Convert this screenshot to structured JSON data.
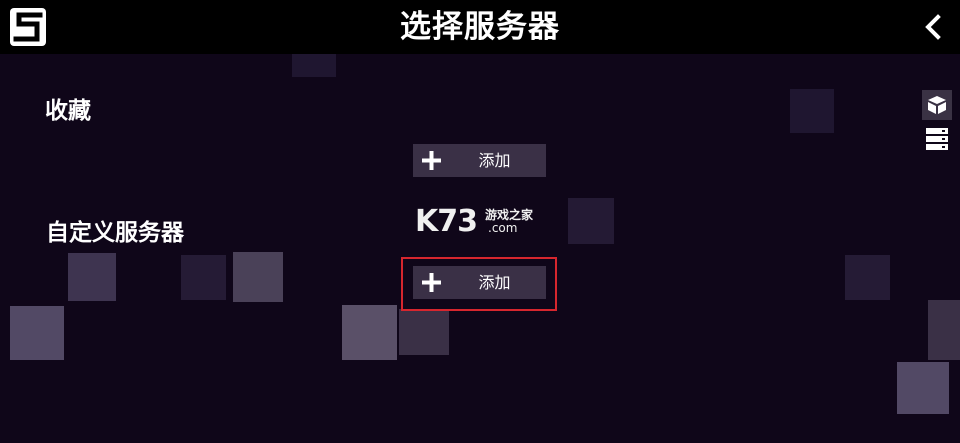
{
  "header": {
    "title": "选择服务器",
    "logo_icon": "s-logo-icon",
    "back_icon": "chevron-left-icon"
  },
  "favorites": {
    "label": "收藏",
    "add_label": "添加"
  },
  "custom_servers": {
    "label": "自定义服务器",
    "add_label": "添加"
  },
  "side_tabs": [
    {
      "icon": "box-icon",
      "active": true
    },
    {
      "icon": "server-list-icon",
      "active": false
    }
  ],
  "watermark": {
    "brand": "K73",
    "tagline": "游戏之家",
    "domain": ".com"
  },
  "colors": {
    "background": "#0f0619",
    "topbar": "#000000",
    "button": "#3a3046",
    "highlight": "#d7262e"
  }
}
